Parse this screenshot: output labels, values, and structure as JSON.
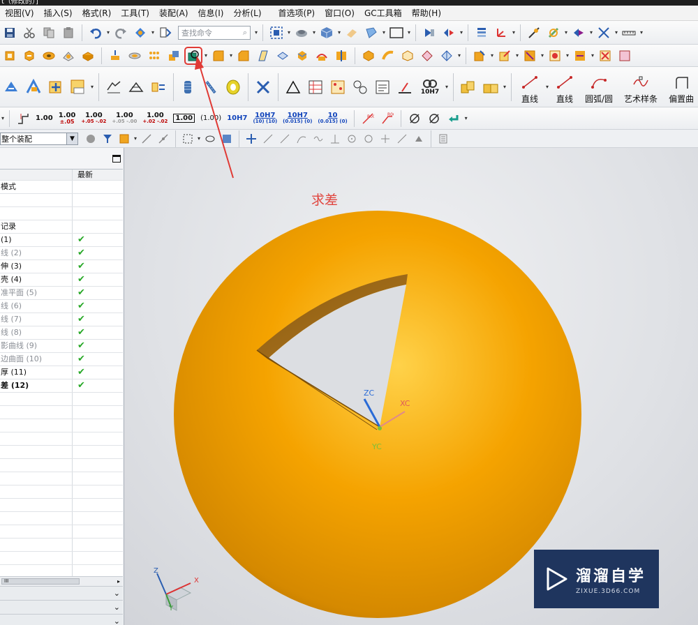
{
  "window": {
    "title": "t（修改的）]"
  },
  "menu": [
    "视图(V)",
    "插入(S)",
    "格式(R)",
    "工具(T)",
    "装配(A)",
    "信息(I)",
    "分析(L)",
    "首选项(P)",
    "窗口(O)",
    "GC工具箱",
    "帮助(H)"
  ],
  "toolbar": {
    "search_placeholder": "查找命令",
    "curve_buttons": [
      "直线",
      "直线",
      "圆弧/圆",
      "艺术样条",
      "偏置曲"
    ],
    "tolerances": [
      {
        "top": "1.00",
        "bottom": ""
      },
      {
        "top": "1.00",
        "bottom": "±.05"
      },
      {
        "top": "1.00",
        "bottom": "+.05 -.02"
      },
      {
        "top": "1.00",
        "bottom": "+.05 -.00"
      },
      {
        "top": "1.00",
        "bottom": "+.02 -.02"
      },
      {
        "top": "1.00",
        "bottom": ""
      },
      {
        "top": "(1.00)",
        "bottom": ""
      },
      {
        "top": "10H7",
        "bottom": ""
      },
      {
        "top": "10H7",
        "bottom": "(10) (10)"
      },
      {
        "top": "10H7",
        "bottom": "(0.015) (0)"
      },
      {
        "top": "10",
        "bottom": "(0.015) (0)"
      }
    ],
    "fit_label": "10H7",
    "assembly_filter": "整个装配"
  },
  "navigator": {
    "column_latest": "最新",
    "rows": [
      {
        "name": "模式",
        "status": "",
        "style": "normal"
      },
      {
        "name": "",
        "status": "",
        "style": "normal"
      },
      {
        "name": "",
        "status": "",
        "style": "normal"
      },
      {
        "name": "记录",
        "status": "",
        "style": "normal"
      },
      {
        "name": "(1)",
        "status": "✔",
        "style": "normal"
      },
      {
        "name": "线 (2)",
        "status": "✔",
        "style": "gray"
      },
      {
        "name": "伸 (3)",
        "status": "✔",
        "style": "normal"
      },
      {
        "name": "壳 (4)",
        "status": "✔",
        "style": "normal"
      },
      {
        "name": "准平面 (5)",
        "status": "✔",
        "style": "gray"
      },
      {
        "name": "线 (6)",
        "status": "✔",
        "style": "gray"
      },
      {
        "name": "线 (7)",
        "status": "✔",
        "style": "gray"
      },
      {
        "name": "线 (8)",
        "status": "✔",
        "style": "gray"
      },
      {
        "name": "影曲线 (9)",
        "status": "✔",
        "style": "gray"
      },
      {
        "name": "边曲面 (10)",
        "status": "✔",
        "style": "gray"
      },
      {
        "name": "厚 (11)",
        "status": "✔",
        "style": "normal"
      },
      {
        "name": "差 (12)",
        "status": "✔",
        "style": "bold"
      },
      {
        "name": "",
        "status": "",
        "style": "normal"
      },
      {
        "name": "",
        "status": "",
        "style": "normal"
      },
      {
        "name": "",
        "status": "",
        "style": "normal"
      },
      {
        "name": "",
        "status": "",
        "style": "normal"
      },
      {
        "name": "",
        "status": "",
        "style": "normal"
      },
      {
        "name": "",
        "status": "",
        "style": "normal"
      },
      {
        "name": "",
        "status": "",
        "style": "normal"
      },
      {
        "name": "",
        "status": "",
        "style": "normal"
      },
      {
        "name": "",
        "status": "",
        "style": "normal"
      },
      {
        "name": "",
        "status": "",
        "style": "normal"
      },
      {
        "name": "",
        "status": "",
        "style": "normal"
      },
      {
        "name": "",
        "status": "",
        "style": "normal"
      },
      {
        "name": "",
        "status": "",
        "style": "normal"
      },
      {
        "name": "",
        "status": "",
        "style": "normal"
      }
    ],
    "scroll_label": "III"
  },
  "viewport": {
    "annotation": "求差",
    "wcs": {
      "x": "XC",
      "y": "YC",
      "z": "ZC"
    },
    "triad": {
      "x": "X",
      "y": "Y",
      "z": "Z"
    },
    "colors": {
      "sphere": "#f5a300",
      "annotation": "#e0463f",
      "arrow": "#e03a35"
    }
  },
  "watermark": {
    "name": "溜溜自学",
    "url": "ZIXUE.3D66.COM"
  }
}
